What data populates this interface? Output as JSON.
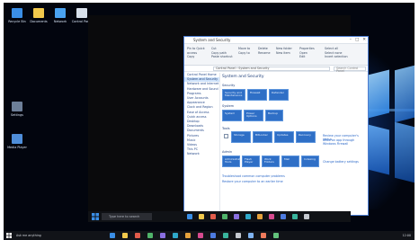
{
  "desktop": {
    "icons": [
      {
        "label": "Recycle Bin",
        "color": "#3a8ee6"
      },
      {
        "label": "Documents",
        "color": "#f2c94c"
      },
      {
        "label": "Network",
        "color": "#4aa3f0"
      },
      {
        "label": "Control Panel",
        "color": "#d8e0ea"
      },
      {
        "label": "Settings",
        "color": "#6d7f98"
      },
      {
        "label": "Media Player",
        "color": "#4f8ed9"
      }
    ],
    "accent": "#2f86e6"
  },
  "window": {
    "title": "System and Security",
    "controls": [
      "–",
      "□",
      "✕"
    ],
    "ribbon": {
      "groups": [
        [
          "Pin to Quick",
          "access",
          "Copy",
          "Paste"
        ],
        [
          "Cut",
          "Copy path",
          "Paste shortcut"
        ],
        [
          "Move to",
          "Copy to"
        ],
        [
          "Delete",
          "Rename"
        ],
        [
          "New folder",
          "New item"
        ],
        [
          "Properties",
          "Open",
          "Edit"
        ],
        [
          "Select all",
          "Select none",
          "Invert selection"
        ]
      ]
    },
    "address": "Control Panel › System and Security",
    "search_placeholder": "Search Control Panel",
    "nav_items": [
      "Control Panel Home",
      "System and Security",
      "Network and Internet",
      "Hardware and Sound",
      "Programs",
      "User Accounts",
      "Appearance",
      "Clock and Region",
      "Ease of Access",
      "Quick access",
      "Desktop",
      "Downloads",
      "Documents",
      "Pictures",
      "Music",
      "Videos",
      "This PC",
      "Network"
    ],
    "content": {
      "heading": "System and Security",
      "sections": [
        {
          "label": "Security",
          "tiles": [
            "Security and Maintenance",
            "Firewall",
            "Defender"
          ]
        },
        {
          "label": "System",
          "tiles": [
            "System",
            "Power Options",
            "Backup"
          ]
        },
        {
          "label": "Tools",
          "tiles": [
            "Storage",
            "BitLocker",
            "Updates",
            "Recovery"
          ]
        },
        {
          "label": "Admin",
          "tiles": [
            "Administrative Tools",
            "Flash Player",
            "Work Folders",
            "Mail",
            "Indexing"
          ]
        }
      ],
      "side_links": [
        "Review your computer's status",
        "Allow an app through Windows Firewall",
        "Change battery settings"
      ],
      "bottom_links": [
        "Troubleshoot common computer problems",
        "Restore your computer to an earlier time"
      ]
    }
  },
  "inner_taskbar": {
    "search_placeholder": "Type here to search",
    "icons": [
      "#3a8ee6",
      "#f2c94c",
      "#e25c4b",
      "#50b36a",
      "#8a6fe0",
      "#2fa8c9",
      "#e6a23c",
      "#d74a8f",
      "#4d7be0",
      "#39b49c",
      "#c5c9d0"
    ]
  },
  "taskbar": {
    "start_label": "Start",
    "search_placeholder": "Ask me anything",
    "clock": "12:00",
    "icons": [
      "#3a8ee6",
      "#f2c94c",
      "#e25c4b",
      "#50b36a",
      "#8a6fe0",
      "#2fa8c9",
      "#e6a23c",
      "#d74a8f",
      "#4d7be0",
      "#39b49c",
      "#c5c9d0",
      "#7fb3f0",
      "#f07b5c",
      "#63c27b"
    ]
  }
}
